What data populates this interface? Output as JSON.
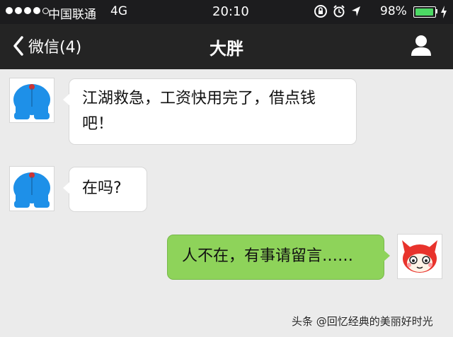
{
  "status_bar": {
    "carrier": "中国联通",
    "network": "4G",
    "time": "20:10",
    "battery": "98%",
    "battery_level": 0.98,
    "icons": [
      "rotation-lock-icon",
      "alarm-icon",
      "location-arrow-icon",
      "charging-bolt-icon"
    ]
  },
  "nav": {
    "back_label": "微信(4)",
    "title": "大胖"
  },
  "messages": [
    {
      "from": "contact",
      "text_line1": "江湖救急，工资快用完了，借点钱",
      "text_line2": "吧！"
    },
    {
      "from": "contact",
      "text": "在吗?"
    },
    {
      "from": "me",
      "text": "人不在，有事请留言……"
    }
  ],
  "watermark": "头条 @回忆经典的美丽好时光",
  "colors": {
    "status_bg": "#1c1c1e",
    "nav_bg": "#242424",
    "chat_bg": "#ebebeb",
    "outgoing_bubble": "#8ed35a",
    "incoming_bubble": "#ffffff",
    "battery": "#4cd964"
  }
}
